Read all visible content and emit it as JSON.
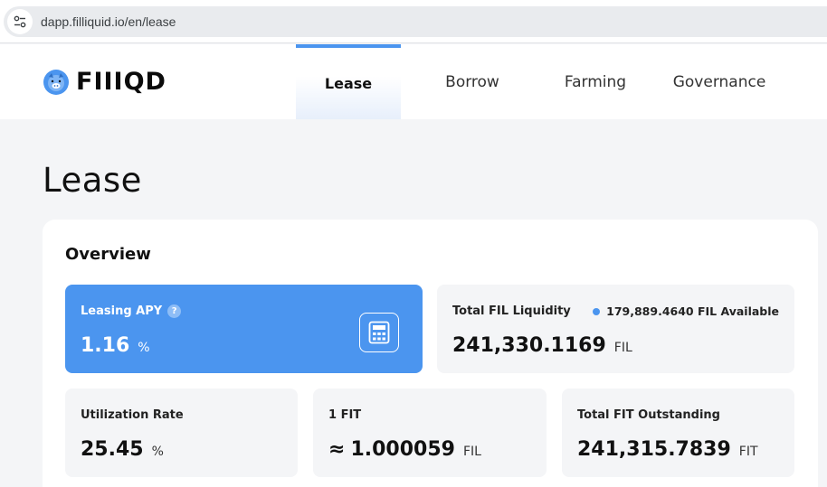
{
  "browser": {
    "url": "dapp.filliquid.io/en/lease"
  },
  "brand": {
    "logo_text_a": "F",
    "logo_text_b": "IIIQ",
    "logo_text_c": "D",
    "accent_color": "#4b95ef"
  },
  "nav": {
    "items": [
      {
        "label": "Lease",
        "active": true
      },
      {
        "label": "Borrow",
        "active": false
      },
      {
        "label": "Farming",
        "active": false
      },
      {
        "label": "Governance",
        "active": false
      }
    ]
  },
  "page": {
    "title": "Lease"
  },
  "overview": {
    "title": "Overview",
    "leasing_apy": {
      "label": "Leasing APY",
      "help": "?",
      "value": "1.16",
      "unit": "%",
      "icon": "calculator-icon"
    },
    "total_liquidity": {
      "label": "Total FIL Liquidity",
      "available": "179,889.4640 FIL Available",
      "value": "241,330.1169",
      "unit": "FIL"
    },
    "utilization": {
      "label": "Utilization Rate",
      "value": "25.45",
      "unit": "%"
    },
    "fit_rate": {
      "label": "1 FIT",
      "approx": "≈",
      "value": "1.000059",
      "unit": "FIL"
    },
    "fit_outstanding": {
      "label": "Total FIT Outstanding",
      "value": "241,315.7839",
      "unit": "FIT"
    }
  }
}
